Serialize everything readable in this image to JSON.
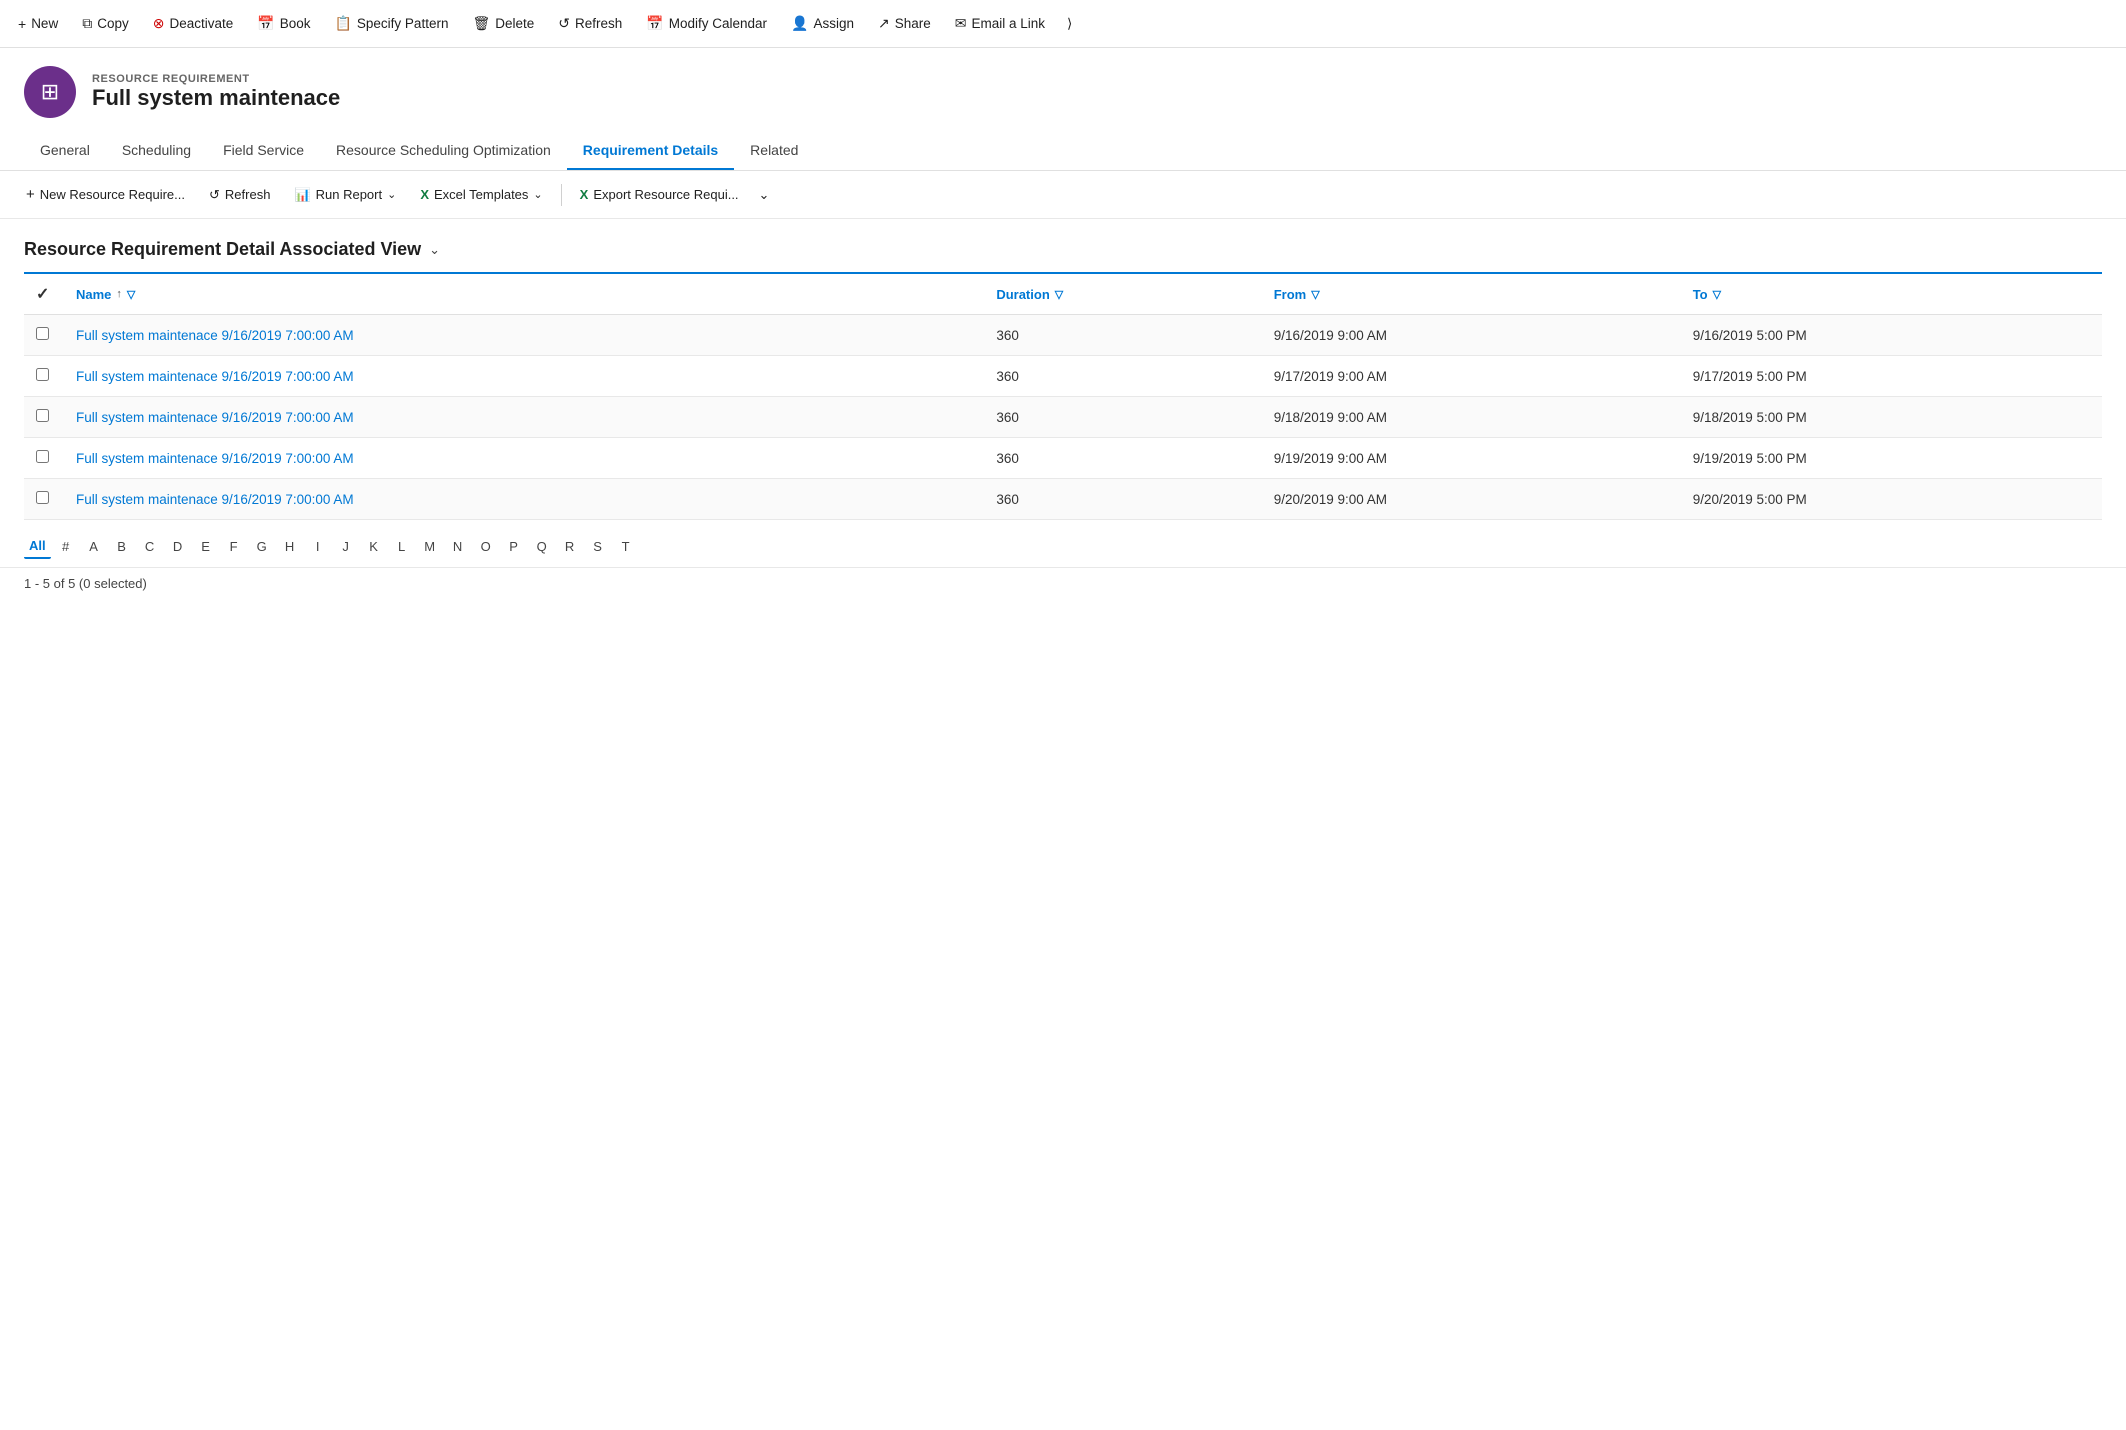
{
  "toolbar": {
    "buttons": [
      {
        "id": "new",
        "icon": "+",
        "label": "New"
      },
      {
        "id": "copy",
        "icon": "⧉",
        "label": "Copy"
      },
      {
        "id": "deactivate",
        "icon": "⊗",
        "label": "Deactivate"
      },
      {
        "id": "book",
        "icon": "📅",
        "label": "Book"
      },
      {
        "id": "specify-pattern",
        "icon": "📋",
        "label": "Specify Pattern"
      },
      {
        "id": "delete",
        "icon": "🗑",
        "label": "Delete"
      },
      {
        "id": "refresh",
        "icon": "↺",
        "label": "Refresh"
      },
      {
        "id": "modify-calendar",
        "icon": "📅",
        "label": "Modify Calendar"
      },
      {
        "id": "assign",
        "icon": "👤",
        "label": "Assign"
      },
      {
        "id": "share",
        "icon": "↗",
        "label": "Share"
      },
      {
        "id": "email-link",
        "icon": "✉",
        "label": "Email a Link"
      }
    ]
  },
  "record": {
    "type": "RESOURCE REQUIREMENT",
    "name": "Full system maintenace",
    "avatar_icon": "⊞"
  },
  "tabs": [
    {
      "id": "general",
      "label": "General",
      "active": false
    },
    {
      "id": "scheduling",
      "label": "Scheduling",
      "active": false
    },
    {
      "id": "field-service",
      "label": "Field Service",
      "active": false
    },
    {
      "id": "rso",
      "label": "Resource Scheduling Optimization",
      "active": false
    },
    {
      "id": "requirement-details",
      "label": "Requirement Details",
      "active": true
    },
    {
      "id": "related",
      "label": "Related",
      "active": false
    }
  ],
  "sub_toolbar": {
    "new_label": "New Resource Require...",
    "refresh_label": "Refresh",
    "run_report_label": "Run Report",
    "excel_templates_label": "Excel Templates",
    "export_label": "Export Resource Requi..."
  },
  "view": {
    "title": "Resource Requirement Detail Associated View",
    "has_chevron": true
  },
  "table": {
    "columns": [
      {
        "id": "name",
        "label": "Name",
        "has_sort": true,
        "has_filter": true
      },
      {
        "id": "duration",
        "label": "Duration",
        "has_sort": false,
        "has_filter": true
      },
      {
        "id": "from",
        "label": "From",
        "has_sort": false,
        "has_filter": true
      },
      {
        "id": "to",
        "label": "To",
        "has_sort": false,
        "has_filter": true
      }
    ],
    "rows": [
      {
        "name": "Full system maintenace 9/16/2019 7:00:00 AM",
        "duration": "360",
        "from": "9/16/2019 9:00 AM",
        "to": "9/16/2019 5:00 PM"
      },
      {
        "name": "Full system maintenace 9/16/2019 7:00:00 AM",
        "duration": "360",
        "from": "9/17/2019 9:00 AM",
        "to": "9/17/2019 5:00 PM"
      },
      {
        "name": "Full system maintenace 9/16/2019 7:00:00 AM",
        "duration": "360",
        "from": "9/18/2019 9:00 AM",
        "to": "9/18/2019 5:00 PM"
      },
      {
        "name": "Full system maintenace 9/16/2019 7:00:00 AM",
        "duration": "360",
        "from": "9/19/2019 9:00 AM",
        "to": "9/19/2019 5:00 PM"
      },
      {
        "name": "Full system maintenace 9/16/2019 7:00:00 AM",
        "duration": "360",
        "from": "9/20/2019 9:00 AM",
        "to": "9/20/2019 5:00 PM"
      }
    ]
  },
  "pagination": {
    "active": "All",
    "letters": [
      "All",
      "#",
      "A",
      "B",
      "C",
      "D",
      "E",
      "F",
      "G",
      "H",
      "I",
      "J",
      "K",
      "L",
      "M",
      "N",
      "O",
      "P",
      "Q",
      "R",
      "S",
      "T"
    ]
  },
  "status": {
    "text": "1 - 5 of 5 (0 selected)"
  }
}
